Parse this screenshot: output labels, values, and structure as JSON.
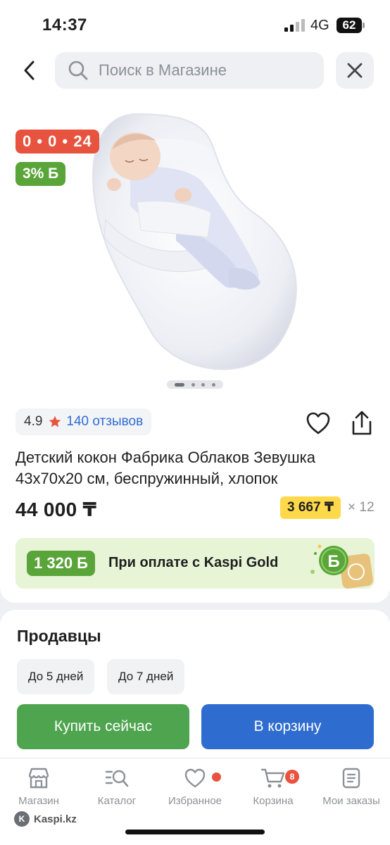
{
  "status_bar": {
    "time": "14:37",
    "network": "4G",
    "battery": "62"
  },
  "search": {
    "placeholder": "Поиск в Магазине"
  },
  "product": {
    "timer_badge": "0 • 0 • 24",
    "bonus_badge": "3% Б",
    "rating": "4.9",
    "reviews": "140 отзывов",
    "title": "Детский кокон Фабрика Облаков Зевушка 43х70х20 см, беспружинный, хлопок",
    "price": "44 000 ₸",
    "installment_price": "3 667 ₸",
    "installment_months": "× 12",
    "image_count": 4,
    "image_active": 0
  },
  "kaspi_gold": {
    "amount": "1 320 Б",
    "text": "При оплате с Kaspi Gold",
    "coin_letter": "Б"
  },
  "sellers": {
    "title": "Продавцы",
    "chips": [
      "До 5 дней",
      "До 7 дней"
    ],
    "buy_now": "Купить сейчас",
    "add_to_cart": "В корзину"
  },
  "tab_bar": {
    "items": [
      {
        "label": "Магазин",
        "icon": "store-icon"
      },
      {
        "label": "Каталог",
        "icon": "catalog-search-icon"
      },
      {
        "label": "Избранное",
        "icon": "heart-icon"
      },
      {
        "label": "Корзина",
        "icon": "cart-icon",
        "badge": "8"
      },
      {
        "label": "Мои заказы",
        "icon": "orders-icon"
      }
    ]
  },
  "watermark": "Kaspi.kz",
  "colors": {
    "accent_red": "#e8533f",
    "accent_green": "#5aa539",
    "buy_green": "#4fa44f",
    "cart_blue": "#2f6ccf",
    "installment_yellow": "#ffd94a",
    "link_blue": "#2f6cd6"
  }
}
